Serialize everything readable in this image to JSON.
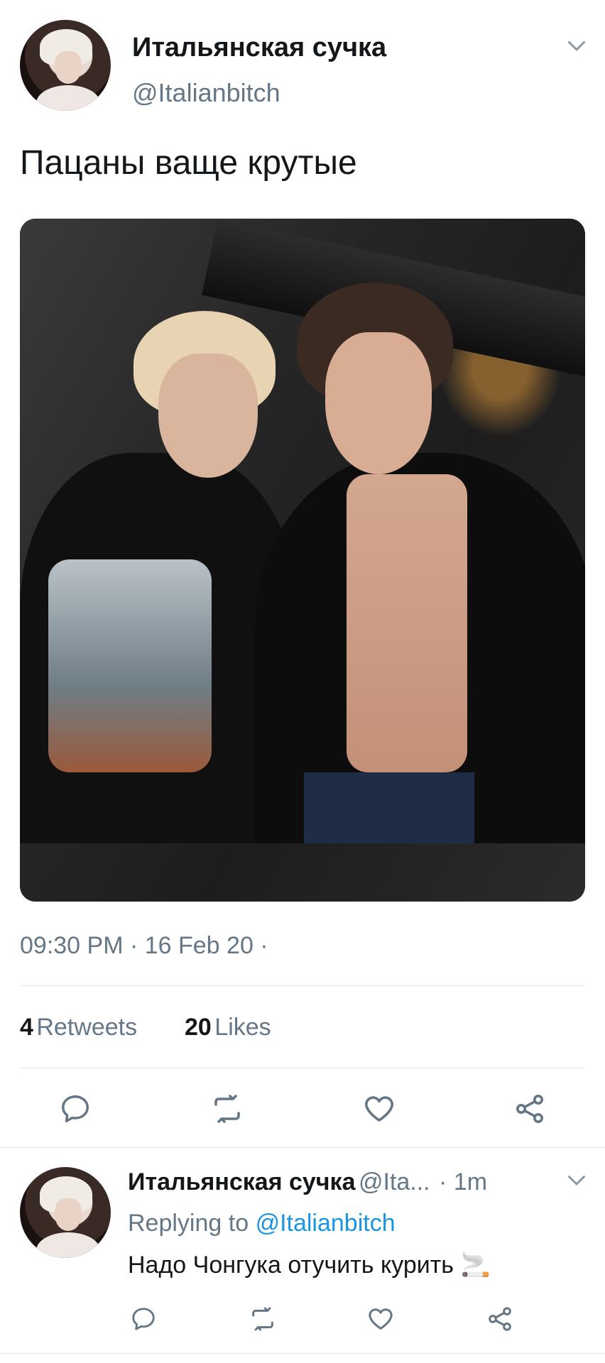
{
  "tweet": {
    "author_name": "Итальянская сучка",
    "author_handle": "@Italianbitch",
    "text": "Пацаны ваще крутые",
    "timestamp": "09:30 PM · 16 Feb 20 ·",
    "retweets_count": "4",
    "retweets_label": "Retweets",
    "likes_count": "20",
    "likes_label": "Likes",
    "menu_icon": "chevron-down-icon",
    "actions": [
      "reply-icon",
      "retweet-icon",
      "like-icon",
      "share-icon"
    ]
  },
  "reply": {
    "author_name": "Итальянская сучка",
    "author_handle": "@Ita...",
    "time": "· 1m",
    "replying_prefix": "Replying to",
    "replying_handle": "@Italianbitch",
    "text": "Надо Чонгука отучить курить",
    "emoji": "🚬",
    "actions": [
      "reply-icon",
      "retweet-icon",
      "like-icon",
      "share-icon"
    ]
  },
  "colors": {
    "accent": "#1b95e0",
    "muted": "#657786",
    "text": "#14171a"
  }
}
